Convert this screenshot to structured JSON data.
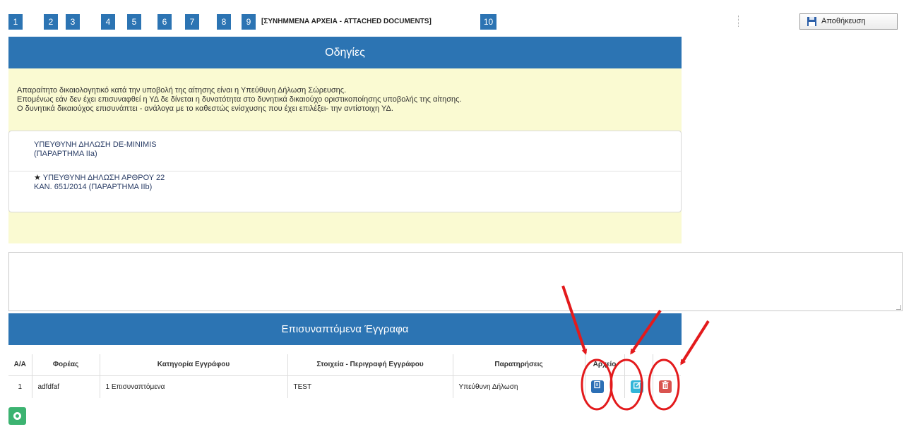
{
  "stepper": {
    "steps": [
      "1",
      "2",
      "3",
      "4",
      "5",
      "6",
      "7",
      "8",
      "9"
    ],
    "current_label": "[ΣΥΝΗΜΜΕΝΑ ΑΡΧΕΙΑ - ATTACHED DOCUMENTS]",
    "last_step": "10"
  },
  "toolbar": {
    "save_label": "Αποθήκευση",
    "save_icon": "floppy-disk-icon"
  },
  "instructions": {
    "title": "Οδηγίες",
    "lines": [
      "Απαραίτητο δικαιολογητικό κατά την υποβολή της αίτησης είναι η Υπεύθυνη Δήλωση Σώρευσης.",
      "Επομένως εάν δεν έχει επισυναφθεί η ΥΔ δε δίνεται η δυνατότητα στο δυνητικά δικαιούχο οριστικοποίησης υποβολής της αίτησης.",
      "Ο δυνητικά δικαιούχος επισυνάπτει - ανάλογα με το καθεστώς ενίσχυσης που έχει επιλέξει- την αντίστοιχη ΥΔ."
    ],
    "documents": [
      {
        "line1": "ΥΠΕΥΘΥΝΗ ΔΗΛΩΣΗ DE-MINIMIS",
        "line2": "(ΠΑΡΑΡΤΗΜΑ IIa)",
        "starred": false
      },
      {
        "line1": "ΥΠΕΥΘΥΝΗ ΔΗΛΩΣΗ ΑΡΘΡΟΥ 22",
        "line2": "ΚΑΝ. 651/2014 (ΠΑΡΑΡΤΗΜΑ IIb)",
        "starred": true,
        "star": "★"
      }
    ]
  },
  "comments": {
    "value": ""
  },
  "attached": {
    "title": "Επισυναπτόμενα Έγγραφα",
    "columns": [
      "Α/Α",
      "Φορέας",
      "Κατηγορία Εγγράφου",
      "Στοιχεία - Περιγραφή Εγγράφου",
      "Παρατηρήσεις",
      "Αρχείο",
      "",
      ""
    ],
    "rows": [
      {
        "aa": "1",
        "foreas": "adfdfaf",
        "category": "1 Επισυναπτόμενα",
        "description": "TEST",
        "notes": "Υπεύθυνη Δήλωση"
      }
    ],
    "actions": {
      "view_icon": "view-document-icon",
      "edit_icon": "edit-icon",
      "delete_icon": "trash-icon"
    }
  },
  "add_button": {
    "icon": "add-circle-icon"
  },
  "annotation_color": "#e31a1c",
  "colors": {
    "primary": "#2c74b3",
    "panel_bg": "#fafad2",
    "view": "#2c6fb5",
    "edit": "#32b5d8",
    "delete": "#d9534f",
    "add": "#3cb371"
  }
}
